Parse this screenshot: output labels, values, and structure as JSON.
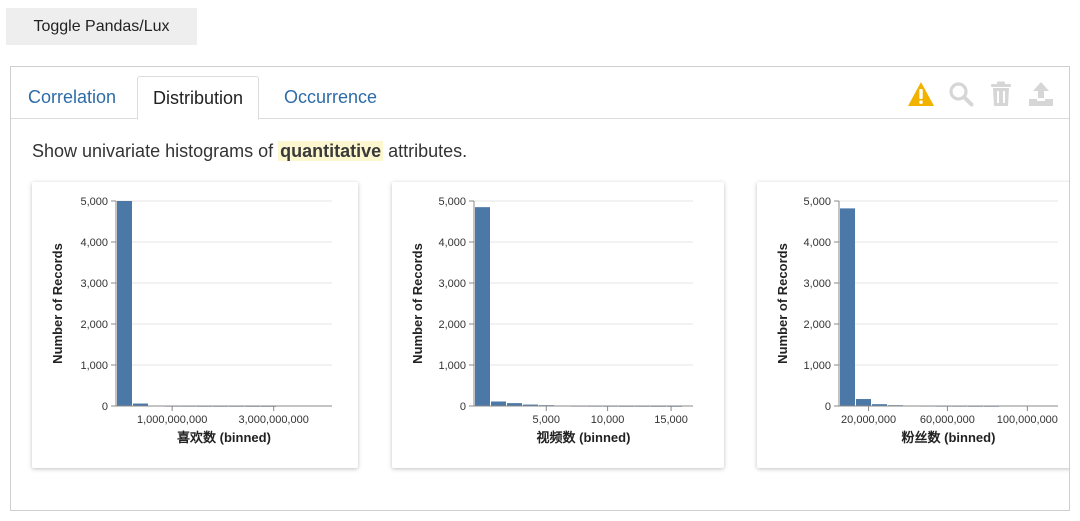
{
  "toggle_button": {
    "label": "Toggle Pandas/Lux"
  },
  "tabs": [
    {
      "label": "Correlation",
      "active": false
    },
    {
      "label": "Distribution",
      "active": true
    },
    {
      "label": "Occurrence",
      "active": false
    }
  ],
  "toolbar": {
    "icons": [
      "warning-icon",
      "search-icon",
      "trash-icon",
      "upload-icon"
    ],
    "warning_color": "#f2b300",
    "disabled_color": "#d6d6d6"
  },
  "description": {
    "before": "Show univariate histograms of ",
    "highlight": "quantitative",
    "after": " attributes."
  },
  "colors": {
    "bar": "#4c78a8",
    "grid": "#e6e6e6",
    "highlight_bg": "#fdf7cf"
  },
  "chart_data": [
    {
      "type": "bar",
      "xlabel": "喜欢数 (binned)",
      "ylabel": "Number of Records",
      "ylim": [
        0,
        5000
      ],
      "yticks": [
        "0",
        "1,000",
        "2,000",
        "3,000",
        "4,000",
        "5,000"
      ],
      "xticks": [
        "1,000,000,000",
        "3,000,000,000"
      ],
      "values": [
        5000,
        60,
        8,
        4,
        3,
        2,
        2,
        2,
        1,
        1
      ]
    },
    {
      "type": "bar",
      "xlabel": "视频数 (binned)",
      "ylabel": "Number of Records",
      "ylim": [
        0,
        5000
      ],
      "yticks": [
        "0",
        "1,000",
        "2,000",
        "3,000",
        "4,000",
        "5,000"
      ],
      "xticks": [
        "5,000",
        "10,000",
        "15,000"
      ],
      "values": [
        4850,
        110,
        70,
        35,
        20,
        8,
        5,
        4,
        3,
        2,
        2,
        1,
        1
      ]
    },
    {
      "type": "bar",
      "xlabel": "粉丝数 (binned)",
      "ylabel": "Number of Records",
      "ylim": [
        0,
        5000
      ],
      "yticks": [
        "0",
        "1,000",
        "2,000",
        "3,000",
        "4,000",
        "5,000"
      ],
      "xticks": [
        "20,000,000",
        "60,000,000",
        "100,000,000"
      ],
      "values": [
        4820,
        170,
        45,
        20,
        10,
        6,
        4,
        3,
        2,
        2
      ]
    }
  ]
}
